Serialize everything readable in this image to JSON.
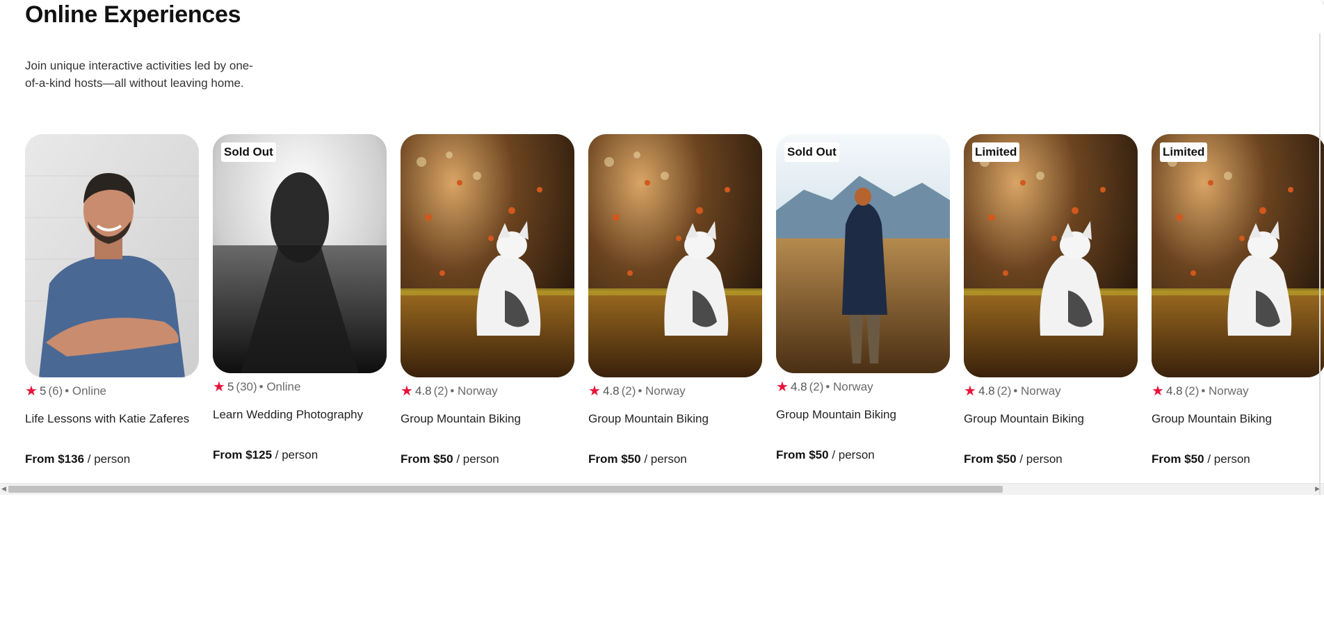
{
  "section": {
    "title": "Online Experiences",
    "description": "Join unique interactive activities led by one-of-a-kind hosts—all without leaving home."
  },
  "cards": [
    {
      "badge": "",
      "rating": "5",
      "reviews": "(6)",
      "location": "• Online",
      "name": "Life Lessons with Katie Zaferes",
      "price": "From $136",
      "unit": " / person",
      "image": "man-smiling-photo"
    },
    {
      "badge": "Sold Out",
      "rating": "5",
      "reviews": "(30)",
      "location": "• Online",
      "name": "Learn Wedding Photography",
      "price": "From $125",
      "unit": " / person",
      "image": "bw-tunnel-photo"
    },
    {
      "badge": "",
      "rating": "4.8",
      "reviews": "(2)",
      "location": "• Norway",
      "name": "Group Mountain Biking",
      "price": "From $50",
      "unit": " / person",
      "image": "puppy-autumn-photo"
    },
    {
      "badge": "",
      "rating": "4.8",
      "reviews": "(2)",
      "location": "• Norway",
      "name": "Group Mountain Biking",
      "price": "From $50",
      "unit": " / person",
      "image": "puppy-autumn-photo"
    },
    {
      "badge": "Sold Out",
      "rating": "4.8",
      "reviews": "(2)",
      "location": "• Norway",
      "name": "Group Mountain Biking",
      "price": "From $50",
      "unit": " / person",
      "image": "man-field-photo"
    },
    {
      "badge": "Limited",
      "rating": "4.8",
      "reviews": "(2)",
      "location": "• Norway",
      "name": "Group Mountain Biking",
      "price": "From $50",
      "unit": " / person",
      "image": "puppy-autumn-photo"
    },
    {
      "badge": "Limited",
      "rating": "4.8",
      "reviews": "(2)",
      "location": "• Norway",
      "name": "Group Mountain Biking",
      "price": "From $50",
      "unit": " / person",
      "image": "puppy-autumn-photo"
    }
  ],
  "icons": {
    "star": "star-icon",
    "scroll_left": "scroll-left-arrow-icon",
    "scroll_right": "scroll-right-arrow-icon"
  },
  "colors": {
    "star": "#e8133b",
    "badge_bg": "#ffffff"
  }
}
